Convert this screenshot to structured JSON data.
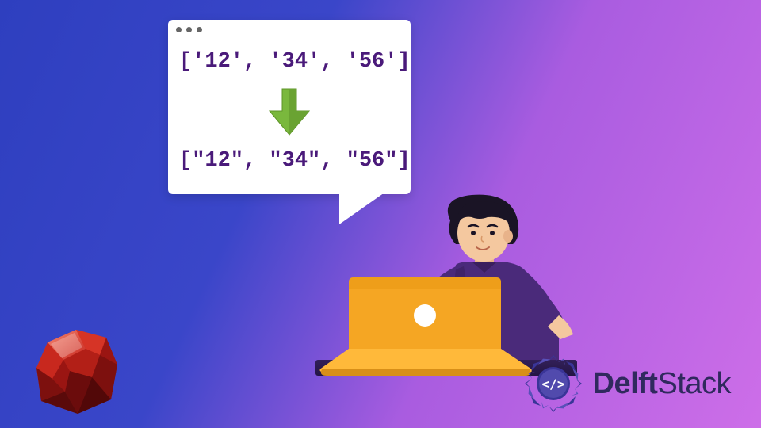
{
  "code": {
    "line1": "['12', '34', '56']",
    "line2": "[\"12\", \"34\", \"56\"]"
  },
  "icons": {
    "window_dots": 3,
    "arrow": "down-arrow-icon",
    "ruby": "ruby-logo",
    "delft": "delftstack-logo"
  },
  "brand": {
    "name_prefix": "Delft",
    "name_suffix": "Stack"
  },
  "colors": {
    "arrow": "#7ab83d",
    "laptop": "#f5a623",
    "shirt": "#4a2a7a",
    "code_text": "#4a1a7a"
  }
}
